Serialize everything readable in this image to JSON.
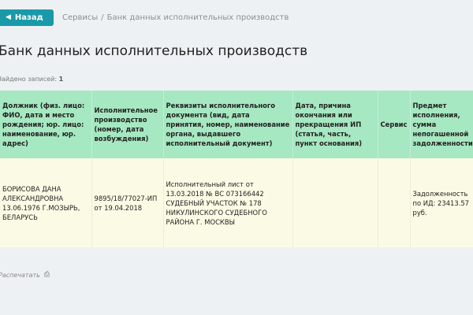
{
  "nav": {
    "back_label": "Назад",
    "breadcrumbs": [
      "Сервисы",
      "Банк данных исполнительных производств"
    ]
  },
  "page": {
    "title": "Банк данных исполнительных производств",
    "found_label": "Найдено записей:",
    "found_count": "1",
    "print_label": "Распечатать"
  },
  "table": {
    "headers": [
      "Должник (физ. лицо: ФИО, дата и место рождения; юр. лицо: наименование, юр. адрес)",
      "Исполнительное производство (номер, дата возбуждения)",
      "Реквизиты исполнительного документа (вид, дата принятия, номер, наименование органа, выдавшего исполнительный документ)",
      "Дата, причина окончания или прекращения ИП (статья, часть, пункт основания)",
      "Сервис",
      "Предмет исполнения, сумма непогашенной задолженности"
    ],
    "rows": [
      {
        "debtor": "БОРИСОВА ДАНА АЛЕКСАНДРОВНА 13.06.1976 Г.МОЗЫРЬ, БЕЛАРУСЬ",
        "proceeding": "9895/18/77027-ИП от 19.04.2018",
        "document": "Исполнительный лист от 13.03.2018 № ВС 073166442 СУДЕБНЫЙ УЧАСТОК № 178 НИКУЛИНСКОГО СУДЕБНОГО РАЙОНА Г. МОСКВЫ",
        "end_date": "",
        "service": "",
        "subject": "Задолженность по ИД: 23413.57 руб."
      }
    ]
  },
  "colors": {
    "accent": "#1a9aa8",
    "header_bg": "#a6e8c1",
    "row_bg": "#fbfbe5",
    "page_bg": "#eef1f4"
  }
}
